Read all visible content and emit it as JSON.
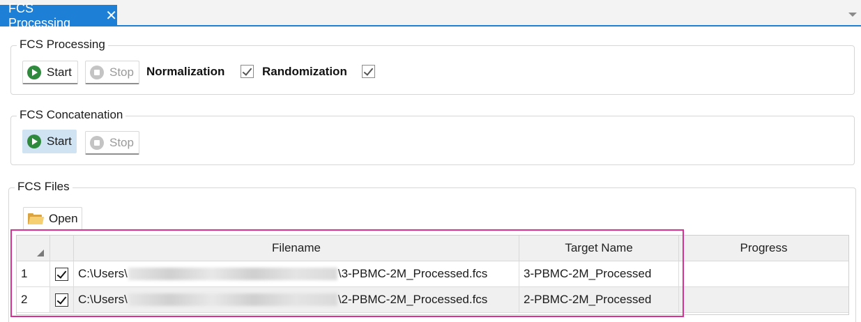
{
  "tab": {
    "title": "FCS Processing"
  },
  "processing": {
    "legend": "FCS Processing",
    "start_label": "Start",
    "stop_label": "Stop",
    "normalization_label": "Normalization",
    "normalization_checked": true,
    "randomization_label": "Randomization",
    "randomization_checked": true
  },
  "concatenation": {
    "legend": "FCS Concatenation",
    "start_label": "Start",
    "stop_label": "Stop"
  },
  "files": {
    "legend": "FCS Files",
    "open_label": "Open",
    "columns": {
      "filename": "Filename",
      "target": "Target Name",
      "progress": "Progress"
    },
    "rows": [
      {
        "index": "1",
        "checked": true,
        "path_prefix": "C:\\Users\\",
        "path_suffix": "\\3-PBMC-2M_Processed.fcs",
        "target": "3-PBMC-2M_Processed",
        "progress": ""
      },
      {
        "index": "2",
        "checked": true,
        "path_prefix": "C:\\Users\\",
        "path_suffix": "\\2-PBMC-2M_Processed.fcs",
        "target": "2-PBMC-2M_Processed",
        "progress": ""
      }
    ]
  },
  "colors": {
    "accent": "#1e7fd6",
    "highlight": "#d63196",
    "play": "#2f8a3e"
  }
}
